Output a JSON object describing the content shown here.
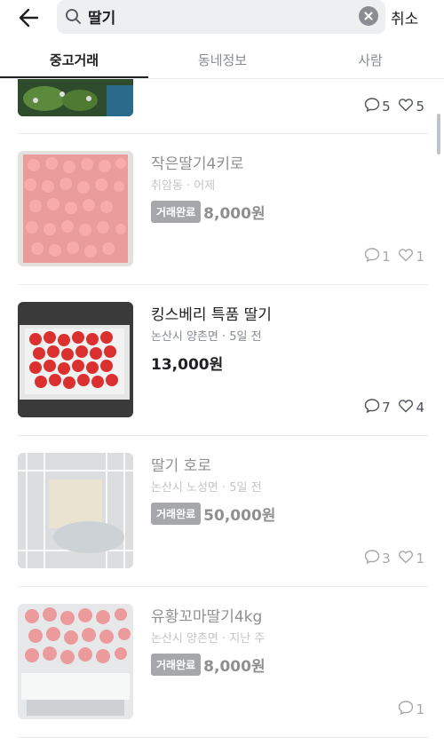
{
  "search": {
    "query": "딸기",
    "cancel_label": "취소"
  },
  "tabs": [
    {
      "label": "중고거래",
      "active": true
    },
    {
      "label": "동네정보",
      "active": false
    },
    {
      "label": "사람",
      "active": false
    }
  ],
  "items": [
    {
      "title": "",
      "meta": "",
      "status": "",
      "price": "",
      "chats": "5",
      "likes": "5",
      "faded": false
    },
    {
      "title": "작은딸기4키로",
      "meta": "취암동 · 어제",
      "status": "거래완료",
      "price": "8,000원",
      "chats": "1",
      "likes": "1",
      "faded": true
    },
    {
      "title": "킹스베리 특품 딸기",
      "meta": "논산시 양촌면 · 5일 전",
      "status": "",
      "price": "13,000원",
      "chats": "7",
      "likes": "4",
      "faded": false
    },
    {
      "title": "딸기 호로",
      "meta": "논산시 노성면 · 5일 전",
      "status": "거래완료",
      "price": "50,000원",
      "chats": "3",
      "likes": "1",
      "faded": true
    },
    {
      "title": "유황꼬마딸기4kg",
      "meta": "논산시 양촌면 · 지난 주",
      "status": "거래완료",
      "price": "8,000원",
      "chats": "1",
      "likes": "",
      "faded": true
    }
  ],
  "colors": {
    "accent": "#212124",
    "badge": "#4d5159",
    "muted": "#868b94",
    "strawberry": "#e0393e"
  },
  "icons": {
    "back": "arrow-left-icon",
    "search": "magnifier-icon",
    "clear": "close-circle-icon",
    "chat": "chat-bubble-icon",
    "like": "heart-icon"
  }
}
